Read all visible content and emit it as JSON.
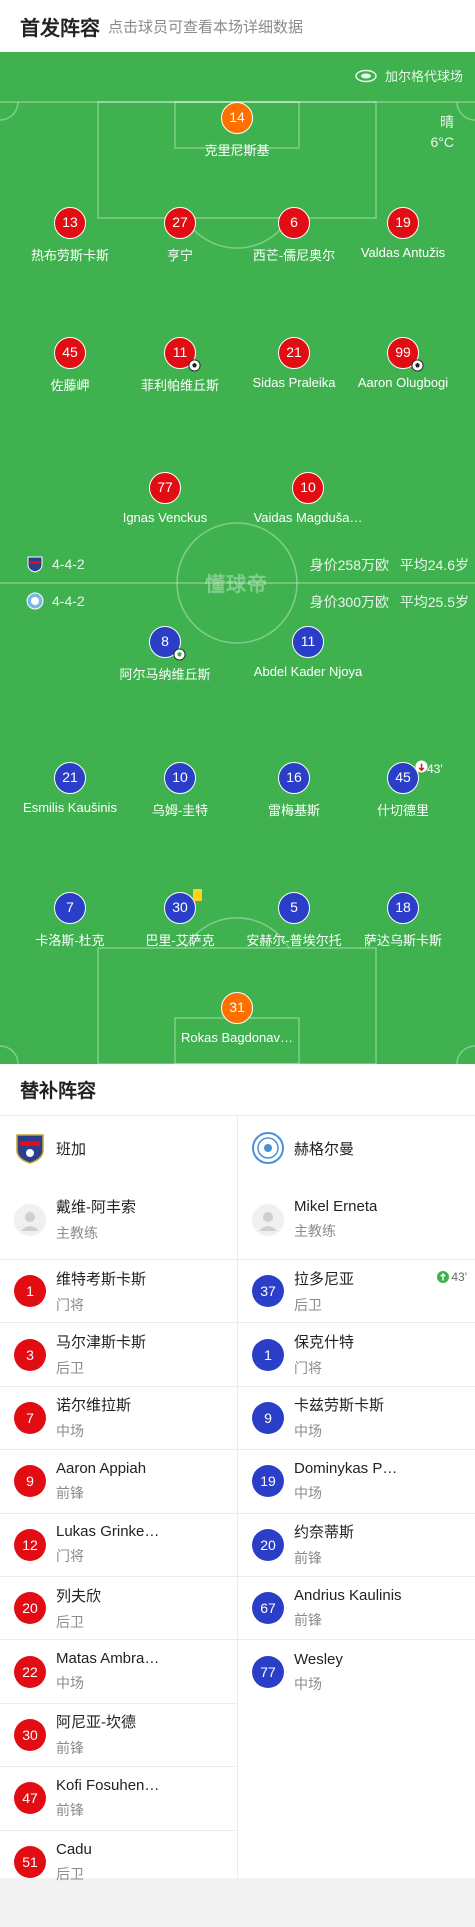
{
  "header": {
    "title": "首发阵容",
    "subtitle": "点击球员可查看本场详细数据"
  },
  "pitch": {
    "stadium": "加尔格代球场",
    "weather": "晴",
    "temperature": "6°C",
    "watermark": "懂球帝",
    "home": {
      "formation": "4-4-2",
      "value": "身价258万欧",
      "age": "平均24.6岁"
    },
    "away": {
      "formation": "4-4-2",
      "value": "身价300万欧",
      "age": "平均25.5岁"
    }
  },
  "home_players": [
    {
      "number": "14",
      "name": "克里尼斯基"
    },
    {
      "number": "13",
      "name": "热布劳斯卡斯"
    },
    {
      "number": "27",
      "name": "亨宁"
    },
    {
      "number": "6",
      "name": "西芒-儒尼奥尔"
    },
    {
      "number": "19",
      "name": "Valdas Antužis"
    },
    {
      "number": "45",
      "name": "佐藤岬"
    },
    {
      "number": "11",
      "name": "菲利帕维丘斯",
      "goal": true
    },
    {
      "number": "21",
      "name": "Sidas Praleika"
    },
    {
      "number": "99",
      "name": "Aaron Olugbogi",
      "goal": true
    },
    {
      "number": "77",
      "name": "Ignas Venckus"
    },
    {
      "number": "10",
      "name": "Vaidas Magduša…"
    }
  ],
  "away_players": [
    {
      "number": "8",
      "name": "阿尔马纳维丘斯",
      "goal": true
    },
    {
      "number": "11",
      "name": "Abdel Kader Njoya"
    },
    {
      "number": "21",
      "name": "Esmilis Kaušinis"
    },
    {
      "number": "10",
      "name": "乌姆-圭特"
    },
    {
      "number": "16",
      "name": "雷梅基斯"
    },
    {
      "number": "45",
      "name": "什切德里",
      "sub_off": "43'"
    },
    {
      "number": "7",
      "name": "卡洛斯-杜克"
    },
    {
      "number": "30",
      "name": "巴里-艾萨克",
      "yellow_card": true
    },
    {
      "number": "5",
      "name": "安赫尔-普埃尔托"
    },
    {
      "number": "18",
      "name": "萨达乌斯卡斯"
    },
    {
      "number": "31",
      "name": "Rokas Bagdonav…"
    }
  ],
  "bench": {
    "title": "替补阵容",
    "home": {
      "team": "班加",
      "coach": {
        "name": "戴维-阿丰索",
        "role": "主教练"
      },
      "subs": [
        {
          "number": "1",
          "name": "维特考斯卡斯",
          "position": "门将"
        },
        {
          "number": "3",
          "name": "马尔津斯卡斯",
          "position": "后卫"
        },
        {
          "number": "7",
          "name": "诺尔维拉斯",
          "position": "中场"
        },
        {
          "number": "9",
          "name": "Aaron Appiah",
          "position": "前锋"
        },
        {
          "number": "12",
          "name": "Lukas Grinke…",
          "position": "门将"
        },
        {
          "number": "20",
          "name": "列夫欣",
          "position": "后卫"
        },
        {
          "number": "22",
          "name": "Matas Ambra…",
          "position": "中场"
        },
        {
          "number": "30",
          "name": "阿尼亚-坎德",
          "position": "前锋"
        },
        {
          "number": "47",
          "name": "Kofi Fosuhen…",
          "position": "前锋"
        },
        {
          "number": "51",
          "name": "Cadu",
          "position": "后卫"
        }
      ]
    },
    "away": {
      "team": "赫格尔曼",
      "coach": {
        "name": "Mikel Erneta",
        "role": "主教练"
      },
      "subs": [
        {
          "number": "37",
          "name": "拉多尼亚",
          "position": "后卫",
          "sub_on": "43'"
        },
        {
          "number": "1",
          "name": "保克什特",
          "position": "门将"
        },
        {
          "number": "9",
          "name": "卡兹劳斯卡斯",
          "position": "中场"
        },
        {
          "number": "19",
          "name": "Dominykas P…",
          "position": "中场"
        },
        {
          "number": "20",
          "name": "约奈蒂斯",
          "position": "前锋"
        },
        {
          "number": "67",
          "name": "Andrius Kaulinis",
          "position": "前锋"
        },
        {
          "number": "77",
          "name": "Wesley",
          "position": "中场"
        }
      ]
    }
  },
  "colors": {
    "pitch": "#3fb24f",
    "home": "#e10d12",
    "home_keeper": "#ff7000",
    "away": "#2b3ec7"
  }
}
